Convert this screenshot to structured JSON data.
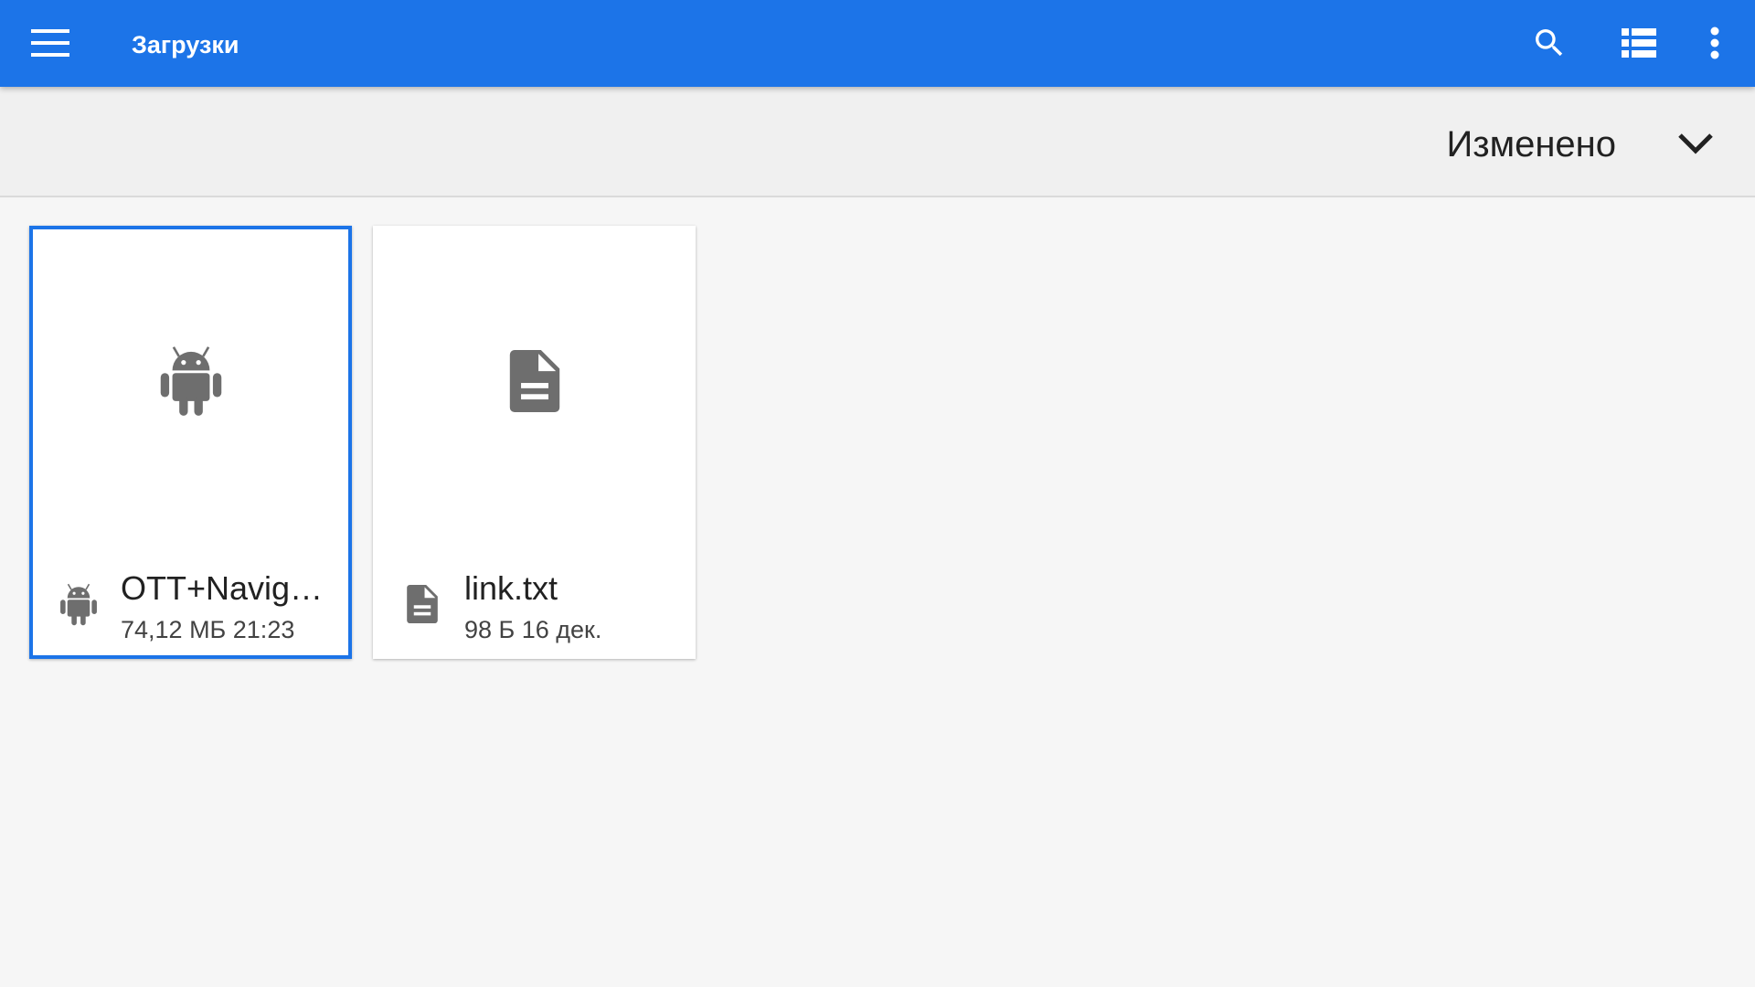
{
  "appbar": {
    "title": "Загрузки",
    "color": "#1c74e8",
    "actions": [
      "menu-icon",
      "search-icon",
      "list-view-icon",
      "more-vert-icon"
    ]
  },
  "sortbar": {
    "label": "Изменено",
    "toggle_icon": "chevron-down-icon"
  },
  "files": [
    {
      "name": "OTT+Navig…",
      "meta": "74,12 МБ 21:23",
      "icon": "android-icon",
      "selected": true
    },
    {
      "name": "link.txt",
      "meta": "98 Б 16 дек.",
      "icon": "document-icon",
      "selected": false
    }
  ]
}
